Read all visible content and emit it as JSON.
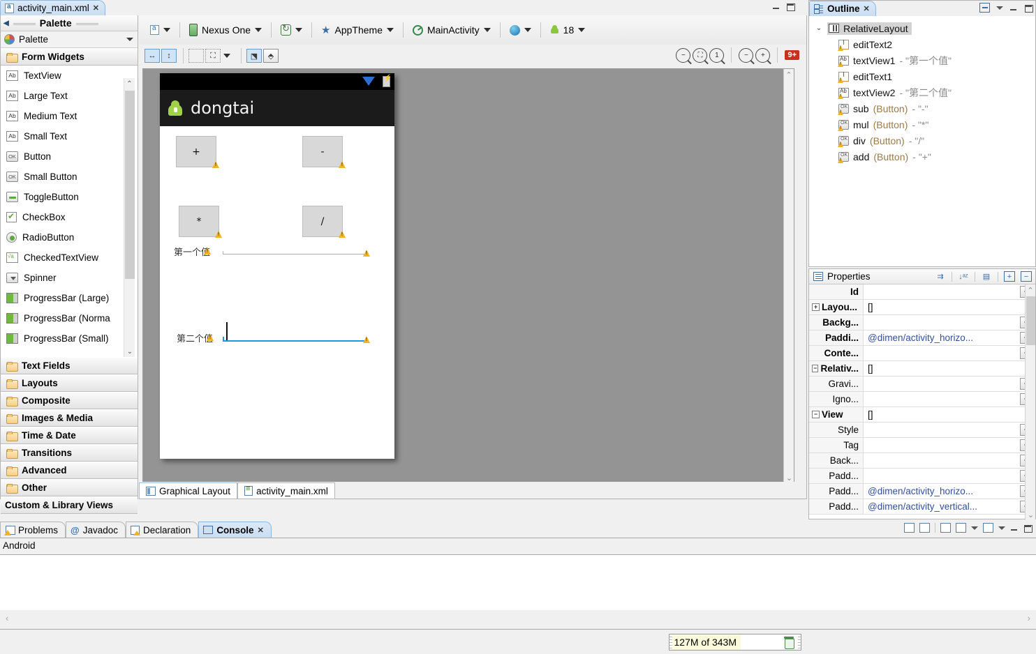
{
  "editor": {
    "tab_label": "activity_main.xml",
    "tab_icon": "xml-document-icon",
    "close_icon": "✕"
  },
  "palette": {
    "header_title": "Palette",
    "title_row_label": "Palette",
    "group_label": "Form Widgets",
    "widgets": [
      {
        "label": "TextView",
        "icon": "ab-icon"
      },
      {
        "label": "Large Text",
        "icon": "ab-icon"
      },
      {
        "label": "Medium Text",
        "icon": "ab-icon"
      },
      {
        "label": "Small Text",
        "icon": "ab-icon"
      },
      {
        "label": "Button",
        "icon": "ok-button-icon"
      },
      {
        "label": "Small Button",
        "icon": "ok-button-icon"
      },
      {
        "label": "ToggleButton",
        "icon": "toggle-icon"
      },
      {
        "label": "CheckBox",
        "icon": "checkbox-icon"
      },
      {
        "label": "RadioButton",
        "icon": "radiobutton-icon"
      },
      {
        "label": "CheckedTextView",
        "icon": "checked-textview-icon"
      },
      {
        "label": "Spinner",
        "icon": "spinner-icon"
      },
      {
        "label": "ProgressBar (Large)",
        "icon": "progressbar-icon"
      },
      {
        "label": "ProgressBar (Norma",
        "icon": "progressbar-icon"
      },
      {
        "label": "ProgressBar (Small)",
        "icon": "progressbar-icon"
      }
    ],
    "categories": [
      "Text Fields",
      "Layouts",
      "Composite",
      "Images & Media",
      "Time & Date",
      "Transitions",
      "Advanced",
      "Other"
    ],
    "custom_views_label": "Custom & Library Views"
  },
  "toolbar": {
    "config_label": "",
    "device": "Nexus One",
    "theme": "AppTheme",
    "activity": "MainActivity",
    "locale": "",
    "api_level": "18",
    "zoom_badge": "9+"
  },
  "device_preview": {
    "app_title": "dongtai",
    "buttons": [
      {
        "label": "+",
        "name": "add"
      },
      {
        "label": "-",
        "name": "sub"
      },
      {
        "label": "*",
        "name": "mul"
      },
      {
        "label": "/",
        "name": "div"
      }
    ],
    "labels": [
      {
        "text": "第一个值"
      },
      {
        "text": "第二个值"
      }
    ]
  },
  "editor_tabs": [
    {
      "label": "Graphical Layout",
      "icon": "graphical-layout-icon",
      "active": true
    },
    {
      "label": "activity_main.xml",
      "icon": "xml-icon",
      "active": false
    }
  ],
  "outline": {
    "tab_label": "Outline",
    "close_icon": "✕",
    "tree": [
      {
        "name": "RelativeLayout",
        "icon": "relativelayout-icon",
        "depth": 0,
        "selected": true,
        "type": "",
        "value": ""
      },
      {
        "name": "editText2",
        "icon": "edittext-icon",
        "depth": 1,
        "type": "",
        "value": ""
      },
      {
        "name": "textView1",
        "icon": "textview-icon",
        "depth": 1,
        "type": "",
        "value": "- \"第一个值\""
      },
      {
        "name": "editText1",
        "icon": "edittext-icon",
        "depth": 1,
        "type": "",
        "value": ""
      },
      {
        "name": "textView2",
        "icon": "textview-icon",
        "depth": 1,
        "type": "",
        "value": "- \"第二个值\""
      },
      {
        "name": "sub",
        "icon": "button-icon",
        "depth": 1,
        "type": "(Button)",
        "value": "- \"-\""
      },
      {
        "name": "mul",
        "icon": "button-icon",
        "depth": 1,
        "type": "(Button)",
        "value": "- \"*\""
      },
      {
        "name": "div",
        "icon": "button-icon",
        "depth": 1,
        "type": "(Button)",
        "value": "- \"/\""
      },
      {
        "name": "add",
        "icon": "button-icon",
        "depth": 1,
        "type": "(Button)",
        "value": "- \"+\""
      }
    ]
  },
  "properties": {
    "title": "Properties",
    "rows": [
      {
        "name": "Id",
        "value": "",
        "kind": "leaf",
        "button": true,
        "indent": 1
      },
      {
        "name": "Layou...",
        "value": "[]",
        "kind": "group",
        "expander": "+",
        "button": false,
        "indent": 0
      },
      {
        "name": "Backg...",
        "value": "",
        "kind": "leaf",
        "button": true,
        "indent": 1
      },
      {
        "name": "Paddi...",
        "value": "@dimen/activity_horizo...",
        "kind": "leaf",
        "button": true,
        "indent": 1
      },
      {
        "name": "Conte...",
        "value": "",
        "kind": "leaf",
        "button": true,
        "indent": 1
      },
      {
        "name": "Relativ...",
        "value": "[]",
        "kind": "group",
        "expander": "−",
        "button": false,
        "indent": 0
      },
      {
        "name": "Gravi...",
        "value": "",
        "kind": "sub",
        "button": true,
        "indent": 2
      },
      {
        "name": "Igno...",
        "value": "",
        "kind": "sub",
        "button": true,
        "indent": 2
      },
      {
        "name": "View",
        "value": "[]",
        "kind": "group",
        "expander": "−",
        "button": false,
        "indent": 0
      },
      {
        "name": "Style",
        "value": "",
        "kind": "sub",
        "button": true,
        "indent": 2
      },
      {
        "name": "Tag",
        "value": "",
        "kind": "sub",
        "button": true,
        "indent": 2
      },
      {
        "name": "Back...",
        "value": "",
        "kind": "sub",
        "button": true,
        "indent": 2
      },
      {
        "name": "Padd...",
        "value": "",
        "kind": "sub",
        "button": true,
        "indent": 2
      },
      {
        "name": "Padd...",
        "value": "@dimen/activity_horizo...",
        "kind": "sub",
        "button": true,
        "indent": 2
      },
      {
        "name": "Padd...",
        "value": "@dimen/activity_vertical...",
        "kind": "sub",
        "button": true,
        "indent": 2
      }
    ]
  },
  "bottom_panel": {
    "tabs": [
      {
        "label": "Problems",
        "icon": "problems-icon",
        "active": false
      },
      {
        "label": "Javadoc",
        "icon": "javadoc-icon",
        "active": false
      },
      {
        "label": "Declaration",
        "icon": "declaration-icon",
        "active": false
      },
      {
        "label": "Console",
        "icon": "console-icon",
        "active": true
      }
    ],
    "console_source": "Android",
    "console_text": ""
  },
  "status_bar": {
    "heap_used": "127M",
    "heap_text": "127M of 343M",
    "trash_icon": "trash-icon"
  }
}
